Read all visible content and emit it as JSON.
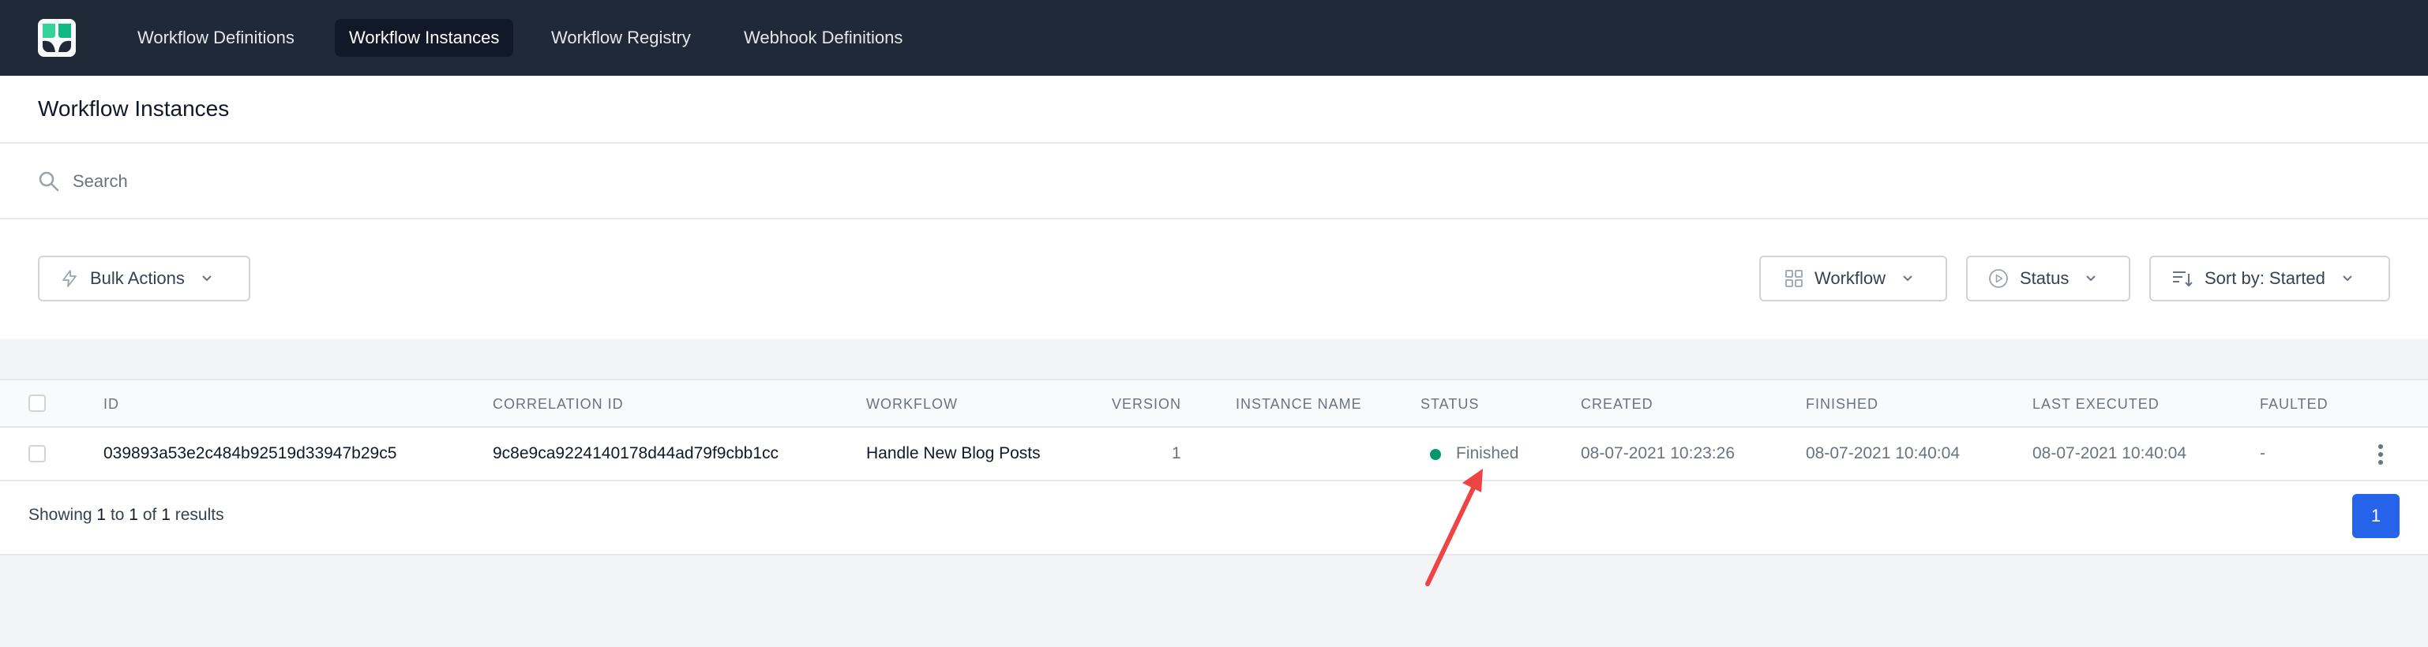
{
  "nav": {
    "items": [
      {
        "label": "Workflow Definitions",
        "active": false
      },
      {
        "label": "Workflow Instances",
        "active": true
      },
      {
        "label": "Workflow Registry",
        "active": false
      },
      {
        "label": "Webhook Definitions",
        "active": false
      }
    ]
  },
  "page": {
    "title": "Workflow Instances"
  },
  "search": {
    "placeholder": "Search",
    "value": ""
  },
  "filters": {
    "bulk_actions": "Bulk Actions",
    "workflow": "Workflow",
    "status": "Status",
    "sort": "Sort by: Started"
  },
  "table": {
    "columns": [
      "ID",
      "CORRELATION ID",
      "WORKFLOW",
      "VERSION",
      "INSTANCE NAME",
      "STATUS",
      "CREATED",
      "FINISHED",
      "LAST EXECUTED",
      "FAULTED"
    ],
    "rows": [
      {
        "id": "039893a53e2c484b92519d33947b29c5",
        "correlation_id": "9c8e9ca9224140178d44ad79f9cbb1cc",
        "workflow": "Handle New Blog Posts",
        "version": "1",
        "instance_name": "",
        "status": "Finished",
        "created": "08-07-2021 10:23:26",
        "finished": "08-07-2021 10:40:04",
        "last_executed": "08-07-2021 10:40:04",
        "faulted": "-"
      }
    ]
  },
  "pagination": {
    "showing": "Showing",
    "from": "1",
    "to_word": "to",
    "to": "1",
    "of_word": "of",
    "total": "1",
    "results_word": "results",
    "current_page": "1"
  },
  "colors": {
    "nav_bg": "#1f2937",
    "status_finished": "#059669",
    "primary": "#2563eb",
    "annotation_arrow": "#ef4444"
  }
}
